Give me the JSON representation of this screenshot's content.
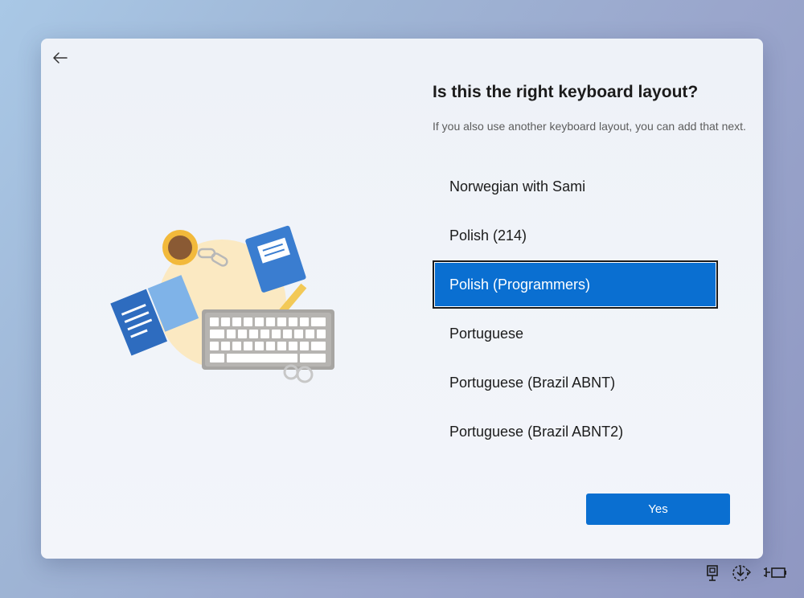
{
  "page": {
    "title": "Is this the right keyboard layout?",
    "subtitle": "If you also use another keyboard layout, you can add that next."
  },
  "layouts": [
    {
      "label": "Norwegian with Sami",
      "selected": false
    },
    {
      "label": "Polish (214)",
      "selected": false
    },
    {
      "label": "Polish (Programmers)",
      "selected": true
    },
    {
      "label": "Portuguese",
      "selected": false
    },
    {
      "label": "Portuguese (Brazil ABNT)",
      "selected": false
    },
    {
      "label": "Portuguese (Brazil ABNT2)",
      "selected": false
    }
  ],
  "actions": {
    "yes_label": "Yes"
  },
  "icons": {
    "back": "back-arrow-icon",
    "tray": [
      "network-icon",
      "accessibility-icon",
      "battery-icon"
    ]
  },
  "colors": {
    "accent": "#0a6fd1",
    "selected_border": "#1a1a1a"
  }
}
